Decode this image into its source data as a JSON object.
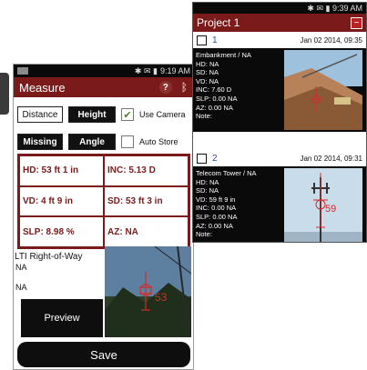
{
  "left": {
    "status_time": "9:19 AM",
    "title": "Measure",
    "help_icon": "question-icon",
    "bt_icon": "bluetooth-icon",
    "mode_buttons": [
      "Distance",
      "Height"
    ],
    "use_camera_label": "Use Camera",
    "use_camera_checked": true,
    "type_buttons": [
      "Missing",
      "Angle"
    ],
    "auto_store_label": "Auto Store",
    "auto_store_checked": false,
    "readings": [
      {
        "text": "HD: 53 ft 1 in"
      },
      {
        "text": "INC:  5.13 D"
      },
      {
        "text": "VD: 4 ft 9 in"
      },
      {
        "text": "SD: 53 ft 3 in"
      },
      {
        "text": "SLP: 8.98 %"
      },
      {
        "text": "AZ: NA"
      }
    ],
    "project_label": "LTI Right-of-Way",
    "na1": "NA",
    "na2": "NA",
    "photo_number": "53",
    "preview_label": "Preview",
    "save_label": "Save"
  },
  "right": {
    "status_time": "9:39 AM",
    "title": "Project 1",
    "minus_icon": "minus-icon",
    "entries": [
      {
        "number": "1",
        "date": "Jan 02 2014, 09:35",
        "lines": [
          "Embankment / NA",
          "HD: NA",
          "SD: NA",
          "VD: NA",
          "INC: 7.60 D",
          "SLP: 0.00 NA",
          "AZ: 0.00 NA",
          "Note:"
        ]
      },
      {
        "number": "2",
        "date": "Jan 02 2014, 09:31",
        "lines": [
          "Telecom Tower / NA",
          "HD: NA",
          "SD: NA",
          "VD: 59 ft 9 in",
          "INC: 0.00 NA",
          "SLP: 0.00 NA",
          "AZ: 0.00 NA",
          "Note:"
        ],
        "photo_number": "59"
      }
    ]
  }
}
